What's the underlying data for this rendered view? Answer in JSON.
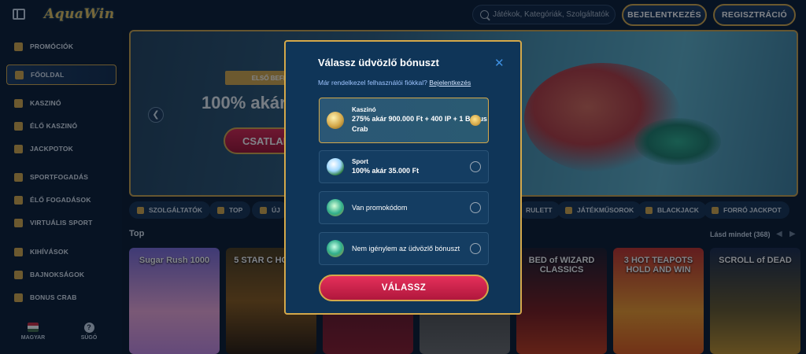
{
  "app": {
    "logo_text": "AquaWin"
  },
  "header": {
    "search_placeholder": "Játékok, Kategóriák, Szolgáltatók",
    "login_label": "BEJELENTKEZÉS",
    "register_label": "REGISZTRÁCIÓ"
  },
  "sidebar": {
    "items": [
      {
        "label": "PROMÓCIÓK"
      },
      {
        "label": "FŐOLDAL"
      },
      {
        "label": "KASZINÓ"
      },
      {
        "label": "ÉLŐ KASZINÓ"
      },
      {
        "label": "JACKPOTOK"
      },
      {
        "label": "SPORTFOGADÁS"
      },
      {
        "label": "ÉLŐ FOGADÁSOK"
      },
      {
        "label": "VIRTUÁLIS SPORT"
      },
      {
        "label": "KIHÍVÁSOK"
      },
      {
        "label": "BAJNOKSÁGOK"
      },
      {
        "label": "BONUS CRAB"
      }
    ],
    "language_label": "MAGYAR",
    "help_label": "SÚGÓ"
  },
  "banner": {
    "ribbon": "ELSŐ BEFIZE",
    "title": "100% akár",
    "cta": "CSATLAK"
  },
  "chips": [
    {
      "label": "SZOLGÁLTATÓK"
    },
    {
      "label": "TOP"
    },
    {
      "label": "ÚJ"
    },
    {
      "label": "RULETT"
    },
    {
      "label": "JÁTÉKMŰSOROK"
    },
    {
      "label": "BLACKJACK"
    },
    {
      "label": "FORRÓ JACKPOT"
    }
  ],
  "games": {
    "section_title": "Top",
    "see_all": "Lásd mindet (368)",
    "cards": [
      {
        "label": "Sugar Rush 1000"
      },
      {
        "label": "5 STAR C HOLD &"
      },
      {
        "label": ""
      },
      {
        "label": ""
      },
      {
        "label": "BED of WIZARD CLASSICS"
      },
      {
        "label": "3 HOT TEAPOTS HOLD AND WIN"
      },
      {
        "label": "SCROLL of DEAD"
      }
    ]
  },
  "modal": {
    "title": "Válassz üdvözlő bónuszt",
    "subtitle": "Már rendelkezel felhasználói fiókkal?",
    "subtitle_link": "Bejelentkezés",
    "options": [
      {
        "heading": "Kaszinó",
        "text": "275% akár 900.000 Ft + 400 IP + 1 Bonus Crab",
        "selected": true
      },
      {
        "heading": "Sport",
        "text": "100% akár 35.000 Ft",
        "selected": false
      },
      {
        "heading": "",
        "text": "Van promokódom",
        "selected": false
      },
      {
        "heading": "",
        "text": "Nem igénylem az üdvözlő bónuszt",
        "selected": false
      }
    ],
    "confirm": "VÁLASSZ"
  },
  "colors": {
    "accent_gold": "#d4a84a",
    "cta_red": "#d8254e",
    "bg": "#0a1a2e"
  }
}
